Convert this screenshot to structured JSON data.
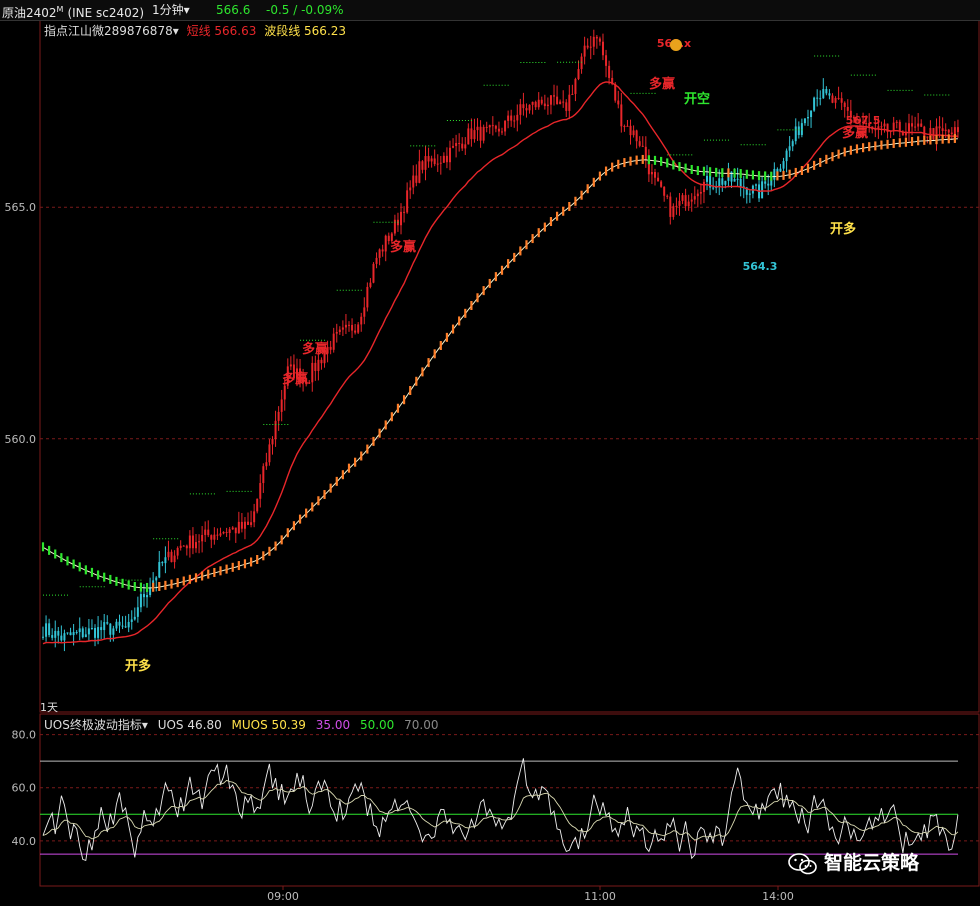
{
  "header": {
    "title": "原油2402",
    "title_sup": "M",
    "exchange": "(INE sc2402)",
    "period": "1分钟",
    "period_arrow": "▾",
    "price": "566.6",
    "change": "-0.5 / -0.09%"
  },
  "legend": {
    "indicator": "指点江山微289876878",
    "arrow": "▾",
    "short_line": "短线 566.63",
    "wave_line": "波段线 566.23",
    "period_marker": "1天"
  },
  "indicator_legend": {
    "name": "UOS终极波动指标",
    "arrow": "▾",
    "uos": "UOS 46.80",
    "muos": "MUOS 50.39",
    "l1": "35.00",
    "l2": "50.00",
    "l3": "70.00"
  },
  "colors": {
    "up": "#e8262a",
    "down": "#33c4d6",
    "orange": "#ff7f2a",
    "green": "#2ee62e",
    "purple": "#d04ee8",
    "yellow": "#ffe14a"
  },
  "chart_data": [
    {
      "type": "candlestick",
      "ylim": [
        554.1,
        569.0
      ],
      "yticks": [
        560.0,
        565.0
      ],
      "ytick_labels": [
        "560.0",
        "565.0"
      ],
      "xtick_labels": [
        "09:00",
        "11:00",
        "14:00"
      ],
      "price_path": [
        [
          0,
          555.9
        ],
        [
          0.03,
          555.7
        ],
        [
          0.06,
          555.8
        ],
        [
          0.1,
          555.9
        ],
        [
          0.14,
          555.9
        ],
        [
          0.15,
          556.4
        ],
        [
          0.19,
          557.3
        ],
        [
          0.22,
          557.7
        ],
        [
          0.28,
          558.0
        ],
        [
          0.33,
          558.1
        ],
        [
          0.36,
          559.8
        ],
        [
          0.39,
          561.5
        ],
        [
          0.42,
          561.3
        ],
        [
          0.46,
          562.1
        ],
        [
          0.5,
          562.5
        ],
        [
          0.53,
          563.9
        ],
        [
          0.56,
          564.6
        ],
        [
          0.6,
          565.9
        ],
        [
          0.64,
          566.1
        ],
        [
          0.68,
          566.6
        ],
        [
          0.72,
          566.6
        ],
        [
          0.76,
          567.1
        ],
        [
          0.8,
          567.3
        ],
        [
          0.83,
          567.1
        ],
        [
          0.86,
          568.3
        ],
        [
          0.88,
          568.8
        ],
        [
          0.9,
          567.8
        ],
        [
          0.92,
          566.9
        ],
        [
          0.95,
          566.4
        ],
        [
          0.97,
          565.6
        ],
        [
          1.0,
          564.9
        ]
      ],
      "price_path_2": [
        [
          0,
          564.9
        ],
        [
          0.05,
          565.5
        ],
        [
          0.1,
          565.6
        ],
        [
          0.15,
          565.3
        ],
        [
          0.2,
          566.2
        ],
        [
          0.25,
          567.5
        ],
        [
          0.3,
          567.1
        ],
        [
          0.35,
          566.6
        ],
        [
          0.4,
          566.7
        ],
        [
          0.45,
          566.6
        ],
        [
          0.5,
          566.6
        ]
      ],
      "short_line_last": 566.63,
      "wave_line_last": 566.23,
      "annotations": [
        {
          "label": "开多",
          "color": "#ffe14a",
          "x": 0.13,
          "y": 555.3
        },
        {
          "label": "多赢",
          "color": "#e8262a",
          "x": 0.37,
          "y": 561.2
        },
        {
          "label": "多赢",
          "color": "#e8262a",
          "x": 0.4,
          "y": 561.9
        },
        {
          "label": "多赢",
          "color": "#e8262a",
          "x": 0.5,
          "y": 564.5
        },
        {
          "label": "多赢",
          "color": "#e8262a",
          "x": 0.82,
          "y": 567.8
        },
        {
          "label": "开空",
          "color": "#2ee62e",
          "x": 0.85,
          "y": 567.5
        },
        {
          "label": "多赢",
          "color": "#e8262a",
          "x": 1.12,
          "y": 566.7
        },
        {
          "label": "开多",
          "color": "#ffe14a",
          "x": 1.17,
          "y": 565.0
        },
        {
          "label": "564.3",
          "color": "#33c4d6",
          "x": 1.04,
          "y": 564.1
        },
        {
          "label": "567.5",
          "color": "#e8262a",
          "x": 1.15,
          "y": 567.3
        },
        {
          "label": "568.x",
          "color": "#e8262a",
          "x": 0.88,
          "y": 568.6
        }
      ]
    },
    {
      "type": "line",
      "name": "UOS",
      "ylim": [
        23,
        87
      ],
      "yticks": [
        40,
        60,
        80
      ],
      "ytick_labels": [
        "40.0",
        "60.0",
        "80.0"
      ],
      "hlines": [
        {
          "value": 35,
          "color": "#d04ee8"
        },
        {
          "value": 50,
          "color": "#2ee62e"
        },
        {
          "value": 70,
          "color": "#bbbbbb"
        }
      ]
    }
  ],
  "watermark": "智能云策略"
}
